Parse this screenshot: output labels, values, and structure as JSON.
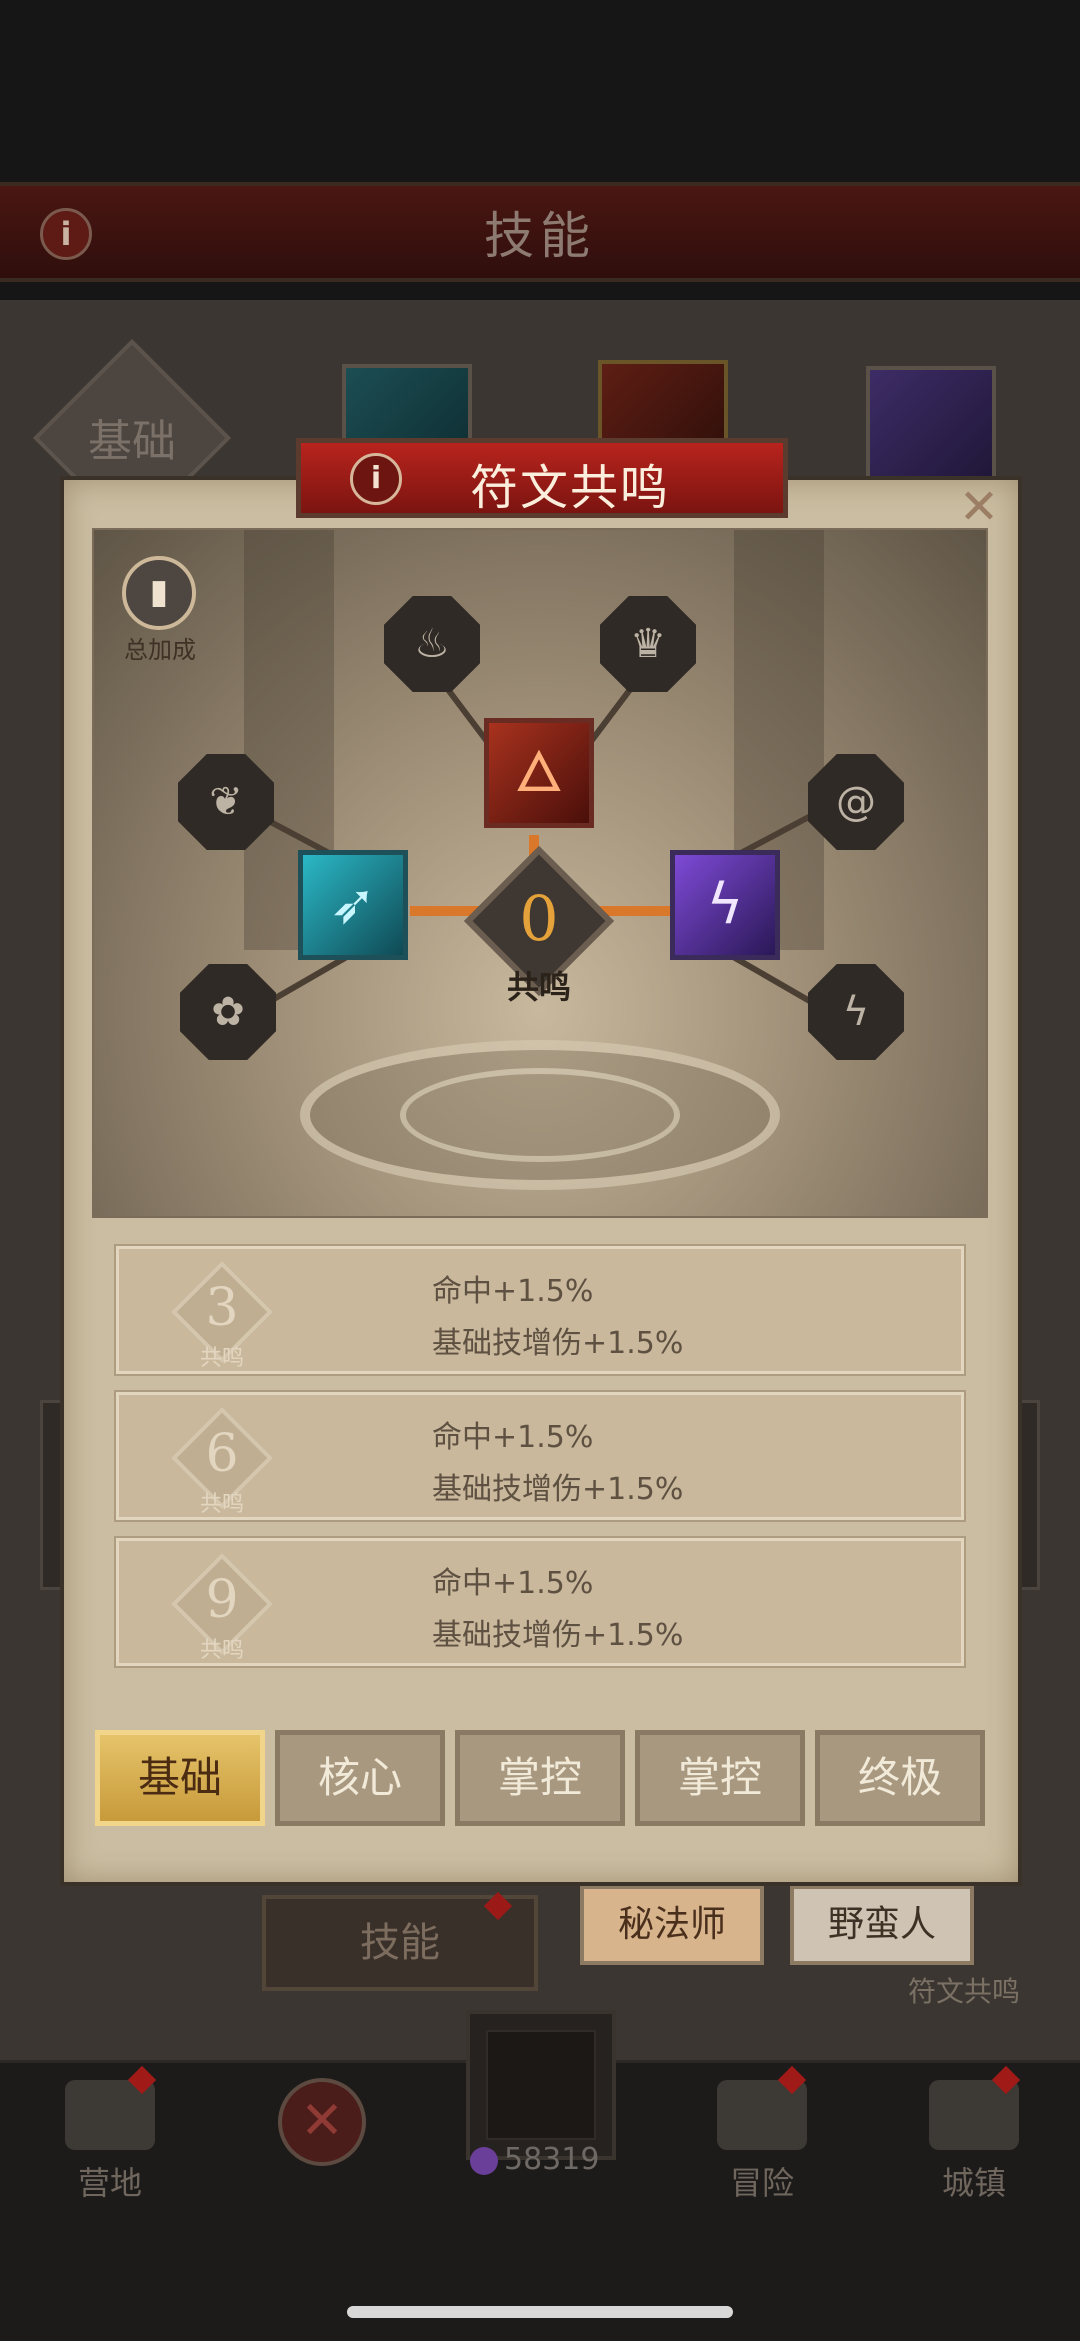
{
  "background": {
    "header_title": "技能",
    "basic_tab": "基础",
    "skill_button": "技能",
    "class_buttons": [
      "秘法师",
      "野蛮人"
    ],
    "rune_label": "符文共鸣"
  },
  "modal": {
    "title": "符文共鸣",
    "bonus_label": "总加成",
    "core_value": "0",
    "core_label": "共鸣",
    "resonance_rows": [
      {
        "level": "3",
        "sub": "共鸣",
        "lines": [
          "命中+1.5%",
          "基础技增伤+1.5%"
        ]
      },
      {
        "level": "6",
        "sub": "共鸣",
        "lines": [
          "命中+1.5%",
          "基础技增伤+1.5%"
        ]
      },
      {
        "level": "9",
        "sub": "共鸣",
        "lines": [
          "命中+1.5%",
          "基础技增伤+1.5%"
        ]
      }
    ],
    "tabs": [
      {
        "label": "基础",
        "active": true
      },
      {
        "label": "核心",
        "active": false
      },
      {
        "label": "掌控",
        "active": false
      },
      {
        "label": "掌控",
        "active": false
      },
      {
        "label": "终极",
        "active": false
      }
    ]
  },
  "nav": {
    "camp": "营地",
    "adventure": "冒险",
    "town": "城镇",
    "currency": "58319"
  }
}
